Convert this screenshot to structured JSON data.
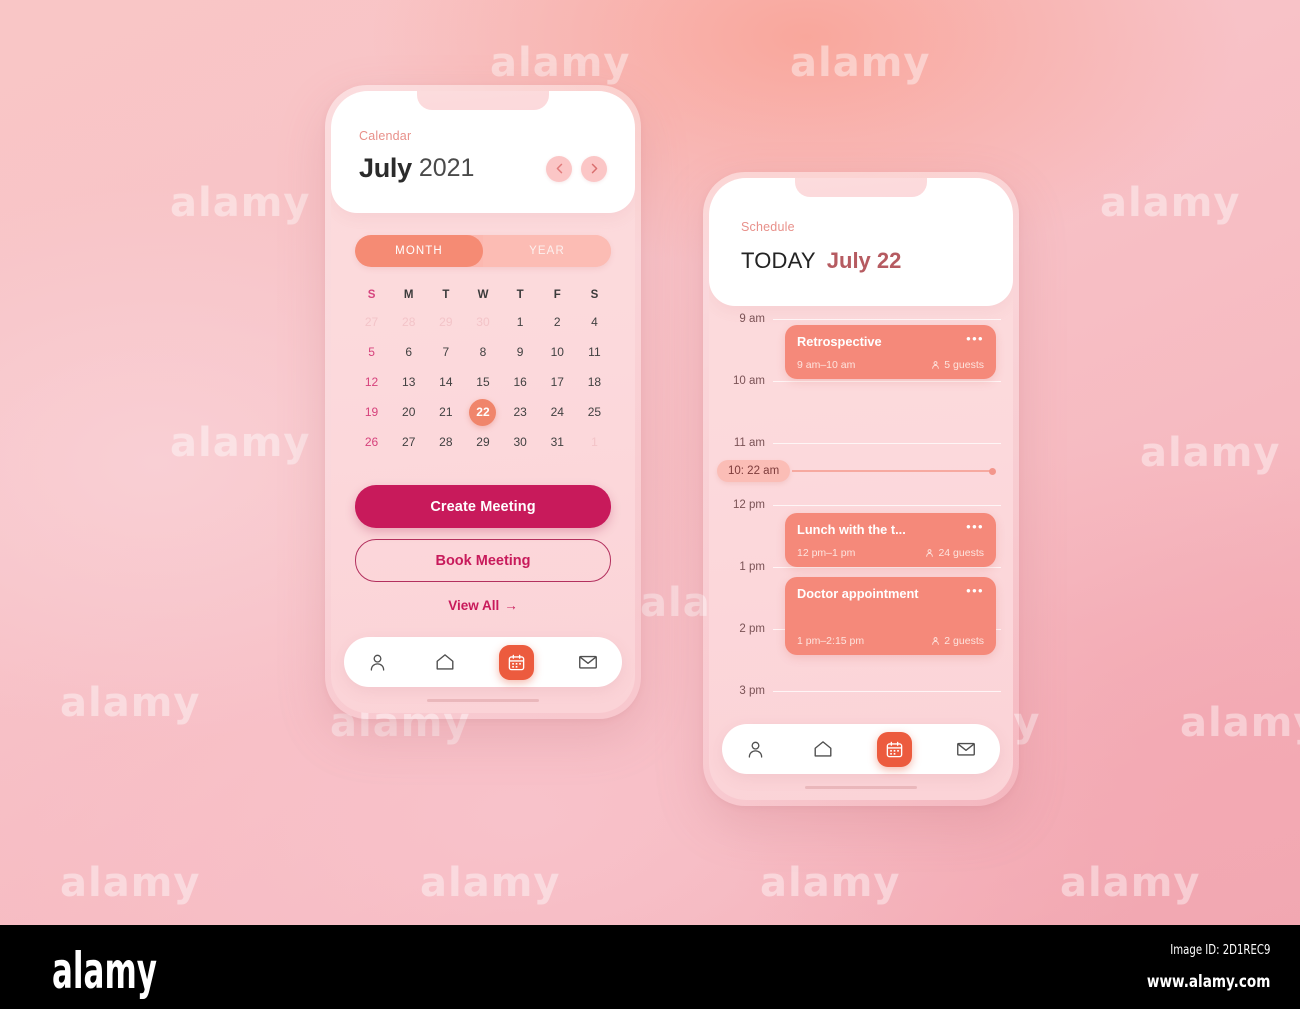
{
  "background": {
    "gradient_colors": [
      "#f9c6c6",
      "#f8c3c8",
      "#f6b9c0",
      "#f0a3ad"
    ],
    "watermark_text": "alamy"
  },
  "colors": {
    "accent_orange": "#f0856b",
    "accent_orange_dark": "#ec5b3e",
    "accent_magenta": "#c81a5b",
    "event_card": "#f5897a",
    "pink_soft": "#fbc6c6",
    "sunday_pink": "#d6427c"
  },
  "phone_one": {
    "name": "calendar-screen",
    "header": {
      "eyebrow": "Calendar",
      "month": "July",
      "year": "2021",
      "prev_icon": "chevron-left-icon",
      "next_icon": "chevron-right-icon"
    },
    "segmented": {
      "options": [
        "MONTH",
        "YEAR"
      ],
      "selected": "MONTH"
    },
    "calendar": {
      "weekdays": [
        "S",
        "M",
        "T",
        "W",
        "T",
        "F",
        "S"
      ],
      "weeks": [
        [
          {
            "d": "27",
            "muted": true
          },
          {
            "d": "28",
            "muted": true
          },
          {
            "d": "29",
            "muted": true
          },
          {
            "d": "30",
            "muted": true
          },
          {
            "d": "1"
          },
          {
            "d": "2"
          },
          {
            "d": "4"
          }
        ],
        [
          {
            "d": "5"
          },
          {
            "d": "6"
          },
          {
            "d": "7"
          },
          {
            "d": "8"
          },
          {
            "d": "9"
          },
          {
            "d": "10"
          },
          {
            "d": "11"
          }
        ],
        [
          {
            "d": "12"
          },
          {
            "d": "13"
          },
          {
            "d": "14"
          },
          {
            "d": "15"
          },
          {
            "d": "16"
          },
          {
            "d": "17"
          },
          {
            "d": "18"
          }
        ],
        [
          {
            "d": "19"
          },
          {
            "d": "20"
          },
          {
            "d": "21"
          },
          {
            "d": "22",
            "today": true
          },
          {
            "d": "23"
          },
          {
            "d": "24"
          },
          {
            "d": "25"
          }
        ],
        [
          {
            "d": "26"
          },
          {
            "d": "27"
          },
          {
            "d": "28"
          },
          {
            "d": "29"
          },
          {
            "d": "30"
          },
          {
            "d": "31"
          },
          {
            "d": "1",
            "muted": true
          }
        ]
      ]
    },
    "actions": {
      "create_label": "Create Meeting",
      "book_label": "Book Meeting",
      "view_all_label": "View All",
      "view_all_arrow": "→"
    },
    "tabbar": {
      "items": [
        {
          "icon": "person-icon",
          "active": false
        },
        {
          "icon": "home-icon",
          "active": false
        },
        {
          "icon": "calendar-icon",
          "active": true
        },
        {
          "icon": "envelope-icon",
          "active": false
        }
      ]
    }
  },
  "phone_two": {
    "name": "schedule-screen",
    "header": {
      "eyebrow": "Schedule",
      "today_label": "TODAY",
      "date": "July 22"
    },
    "timeline": {
      "hours": [
        "9 am",
        "10 am",
        "11 am",
        "12 pm",
        "1 pm",
        "2 pm",
        "3 pm"
      ],
      "current_time": "10: 22 am"
    },
    "events": [
      {
        "title": "Retrospective",
        "time": "9 am–10 am",
        "guests": "5 guests",
        "menu_icon": "ellipsis-icon",
        "guest_icon": "person-icon"
      },
      {
        "title": "Lunch with the t...",
        "time": "12 pm–1 pm",
        "guests": "24 guests",
        "menu_icon": "ellipsis-icon",
        "guest_icon": "person-icon"
      },
      {
        "title": "Doctor appointment",
        "time": "1 pm–2:15 pm",
        "guests": "2 guests",
        "menu_icon": "ellipsis-icon",
        "guest_icon": "person-icon"
      }
    ],
    "tabbar": {
      "items": [
        {
          "icon": "person-icon",
          "active": false
        },
        {
          "icon": "home-icon",
          "active": false
        },
        {
          "icon": "calendar-icon",
          "active": true
        },
        {
          "icon": "envelope-icon",
          "active": false
        }
      ]
    }
  },
  "footer": {
    "logo": "alamy",
    "image_id": "Image ID: 2D1REC9",
    "url": "www.alamy.com"
  }
}
